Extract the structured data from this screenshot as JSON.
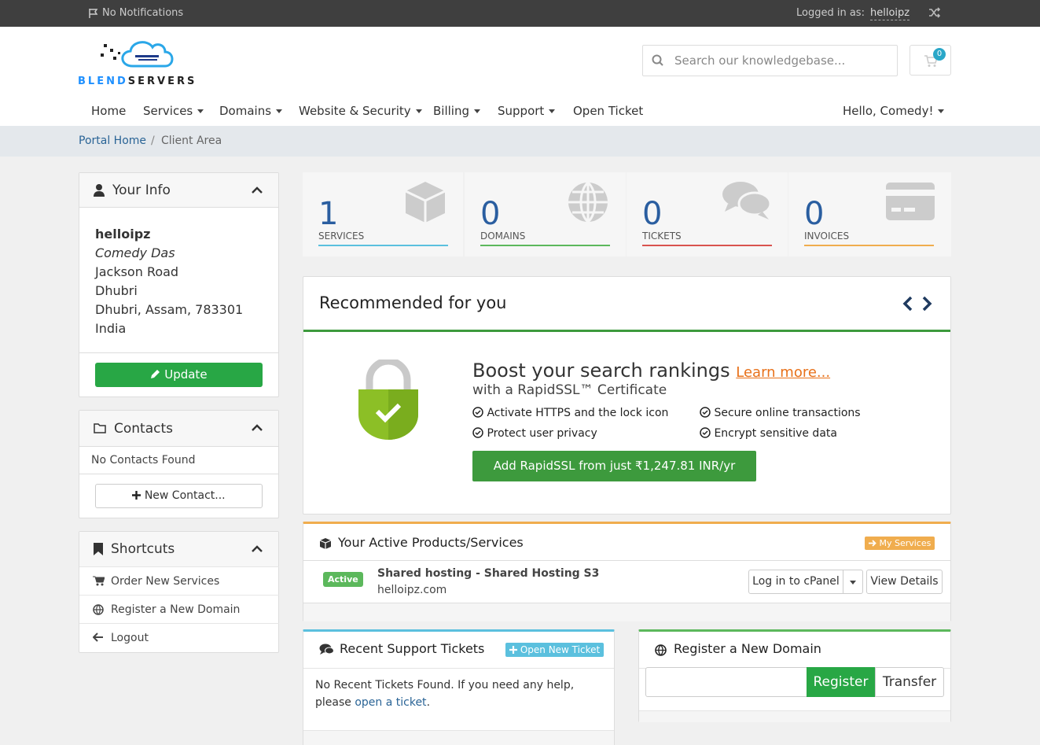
{
  "topbar": {
    "notifications": "No Notifications",
    "logged_in_label": "Logged in as:",
    "username": "helloipz"
  },
  "brand": {
    "part1": "BLEND",
    "part2": "SERVERS"
  },
  "search": {
    "placeholder": "Search our knowledgebase..."
  },
  "cart": {
    "count": "0"
  },
  "nav": {
    "home": "Home",
    "services": "Services",
    "domains": "Domains",
    "website_security": "Website & Security",
    "billing": "Billing",
    "support": "Support",
    "open_ticket": "Open Ticket",
    "hello": "Hello, Comedy!"
  },
  "breadcrumb": {
    "home": "Portal Home",
    "separator": "/",
    "current": "Client Area"
  },
  "your_info": {
    "title": "Your Info",
    "username": "helloipz",
    "name": "Comedy Das",
    "address1": "Jackson Road",
    "city": "Dhubri",
    "region": "Dhubri, Assam, 783301",
    "country": "India",
    "update_label": "Update"
  },
  "contacts": {
    "title": "Contacts",
    "empty": "No Contacts Found",
    "new_label": "New Contact..."
  },
  "shortcuts": {
    "title": "Shortcuts",
    "items": [
      "Order New Services",
      "Register a New Domain",
      "Logout"
    ]
  },
  "stats": [
    {
      "value": "1",
      "label": "SERVICES",
      "color": "#5bc0de"
    },
    {
      "value": "0",
      "label": "DOMAINS",
      "color": "#5cb85c"
    },
    {
      "value": "0",
      "label": "TICKETS",
      "color": "#d9534f"
    },
    {
      "value": "0",
      "label": "INVOICES",
      "color": "#f0ad4e"
    }
  ],
  "recommended": {
    "title": "Recommended for you",
    "headline": "Boost your search rankings",
    "learn_more": "Learn more...",
    "subline": "with a RapidSSL™ Certificate",
    "features": [
      "Activate HTTPS and the lock icon",
      "Secure online transactions",
      "Protect user privacy",
      "Encrypt sensitive data"
    ],
    "cta": "Add RapidSSL from just ₹1,247.81 INR/yr"
  },
  "products": {
    "title": "Your Active Products/Services",
    "my_services": "My Services",
    "status": "Active",
    "product_name": "Shared hosting - Shared Hosting S3",
    "domain": "helloipz.com",
    "login_label": "Log in to cPanel",
    "details_label": "View Details"
  },
  "tickets": {
    "title": "Recent Support Tickets",
    "open_new": "Open New Ticket",
    "empty_text": "No Recent Tickets Found. If you need any help, please",
    "link": "open a ticket",
    "period": "."
  },
  "register_domain": {
    "title": "Register a New Domain",
    "register_label": "Register",
    "transfer_label": "Transfer"
  },
  "colors": {
    "topbar": "#3f3f3f",
    "accent_green": "#28a745",
    "link_blue": "#2a6496",
    "orange": "#e8711a"
  }
}
